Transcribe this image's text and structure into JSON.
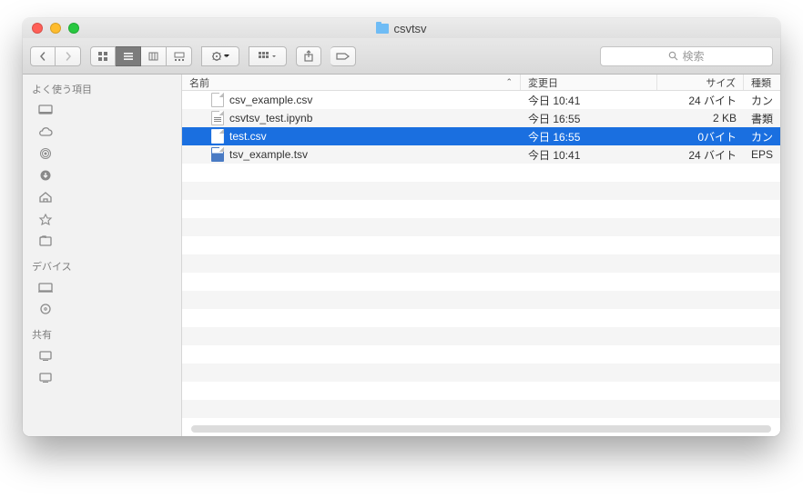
{
  "window": {
    "title": "csvtsv"
  },
  "toolbar": {
    "search_placeholder": "検索"
  },
  "sidebar": {
    "favorites_label": "よく使う項目",
    "devices_label": "デバイス",
    "shared_label": "共有"
  },
  "columns": {
    "name": "名前",
    "date": "変更日",
    "size": "サイズ",
    "kind": "種類"
  },
  "files": [
    {
      "name": "csv_example.csv",
      "date": "今日 10:41",
      "size": "24 バイト",
      "kind": "カン",
      "icon": "plain",
      "selected": false
    },
    {
      "name": "csvtsv_test.ipynb",
      "date": "今日 16:55",
      "size": "2 KB",
      "kind": "書類",
      "icon": "ipynb",
      "selected": false
    },
    {
      "name": "test.csv",
      "date": "今日 16:55",
      "size": "0バイト",
      "kind": "カン",
      "icon": "plain",
      "selected": true
    },
    {
      "name": "tsv_example.tsv",
      "date": "今日 10:41",
      "size": "24 バイト",
      "kind": "EPS",
      "icon": "tsv",
      "selected": false
    }
  ]
}
